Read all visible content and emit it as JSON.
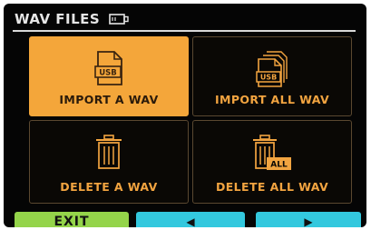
{
  "header": {
    "title": "WAV FILES",
    "icon": "sd-card-icon"
  },
  "tiles": [
    {
      "label": "IMPORT A WAV",
      "badge": "USB",
      "icon": "usb-file-icon",
      "selected": true
    },
    {
      "label": "IMPORT ALL WAV",
      "badge": "USB",
      "icon": "usb-files-stack-icon",
      "selected": false
    },
    {
      "label": "DELETE A WAV",
      "icon": "trash-icon",
      "selected": false
    },
    {
      "label": "DELETE ALL WAV",
      "badge": "ALL",
      "icon": "trash-all-icon",
      "selected": false
    }
  ],
  "footer": {
    "exit_label": "EXIT",
    "prev_label": "◀",
    "next_label": "▶"
  },
  "colors": {
    "accent": "#f4a63a",
    "exit": "#94d44a",
    "nav": "#33c8de"
  }
}
